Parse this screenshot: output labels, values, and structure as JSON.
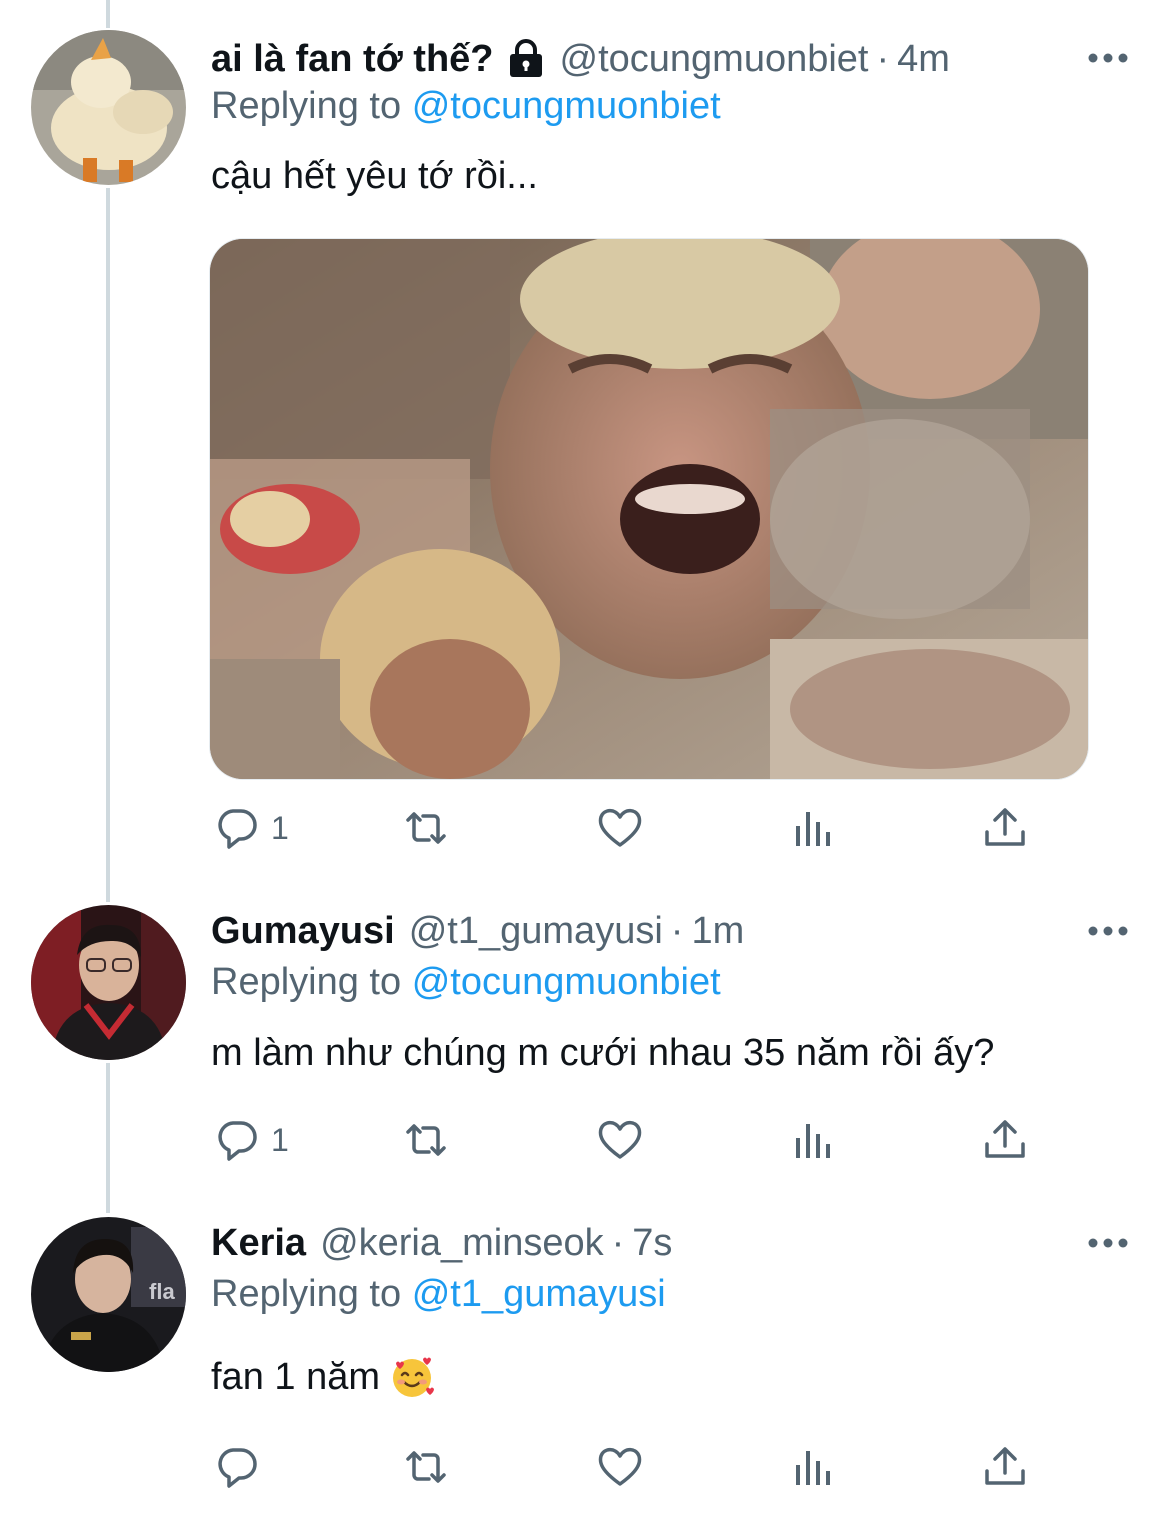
{
  "tweets": [
    {
      "display_name": "ai là fan tớ thế?",
      "protected": true,
      "handle": "@tocungmuonbiet",
      "separator": "·",
      "time": "4m",
      "replying_prefix": "Replying to",
      "replying_to": "@tocungmuonbiet",
      "text": "cậu hết yêu tớ rồi...",
      "has_media": true,
      "avatar_icon": "duck-avatar",
      "reply_count": "1"
    },
    {
      "display_name": "Gumayusi",
      "protected": false,
      "handle": "@t1_gumayusi",
      "separator": "·",
      "time": "1m",
      "replying_prefix": "Replying to",
      "replying_to": "@tocungmuonbiet",
      "text": "m làm như chúng m cưới nhau 35 năm rồi ấy?",
      "has_media": false,
      "avatar_icon": "person-avatar",
      "reply_count": "1"
    },
    {
      "display_name": "Keria",
      "protected": false,
      "handle": "@keria_minseok",
      "separator": "·",
      "time": "7s",
      "replying_prefix": "Replying to",
      "replying_to": "@t1_gumayusi",
      "text": "fan 1 năm",
      "emoji": "smiling-face-with-hearts",
      "has_media": false,
      "avatar_icon": "person-avatar",
      "reply_count": ""
    }
  ],
  "colors": {
    "text": "#0f1419",
    "secondary": "#536471",
    "link": "#1d9bf0",
    "thread_line": "#cfd9de"
  },
  "icons": [
    "reply-icon",
    "retweet-icon",
    "like-icon",
    "views-icon",
    "share-icon",
    "more-icon",
    "lock-icon"
  ]
}
